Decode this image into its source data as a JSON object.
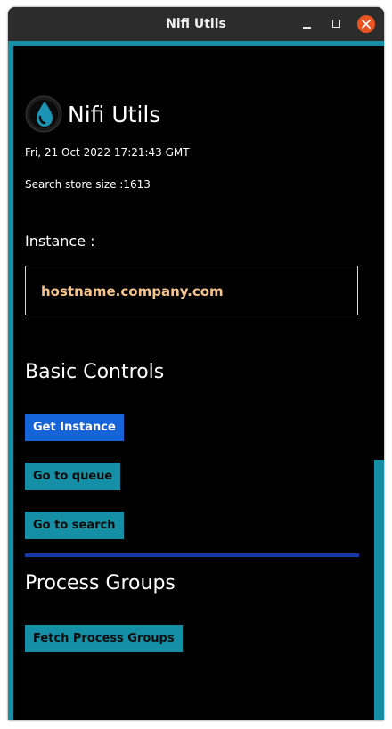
{
  "window": {
    "title": "Nifi Utils"
  },
  "header": {
    "app_name": "Nifi Utils",
    "datetime": "Fri, 21 Oct 2022 17:21:43 GMT",
    "search_store_text": "Search store size :1613"
  },
  "instance": {
    "label": "Instance :",
    "value": "hostname.company.com"
  },
  "basic_controls": {
    "heading": "Basic Controls",
    "get_instance_label": "Get Instance",
    "go_to_queue_label": "Go to queue",
    "go_to_search_label": "Go to search"
  },
  "process_groups": {
    "heading": "Process Groups",
    "fetch_label": "Fetch Process Groups"
  },
  "icons": {
    "logo": "water-drop-icon",
    "minimize": "minimize-icon",
    "maximize": "maximize-icon",
    "close": "close-icon"
  },
  "colors": {
    "accent": "#148fa6",
    "primary_button": "#1565d8",
    "divider": "#1738a8",
    "instance_text": "#f5c38a",
    "close_button": "#e95420"
  }
}
